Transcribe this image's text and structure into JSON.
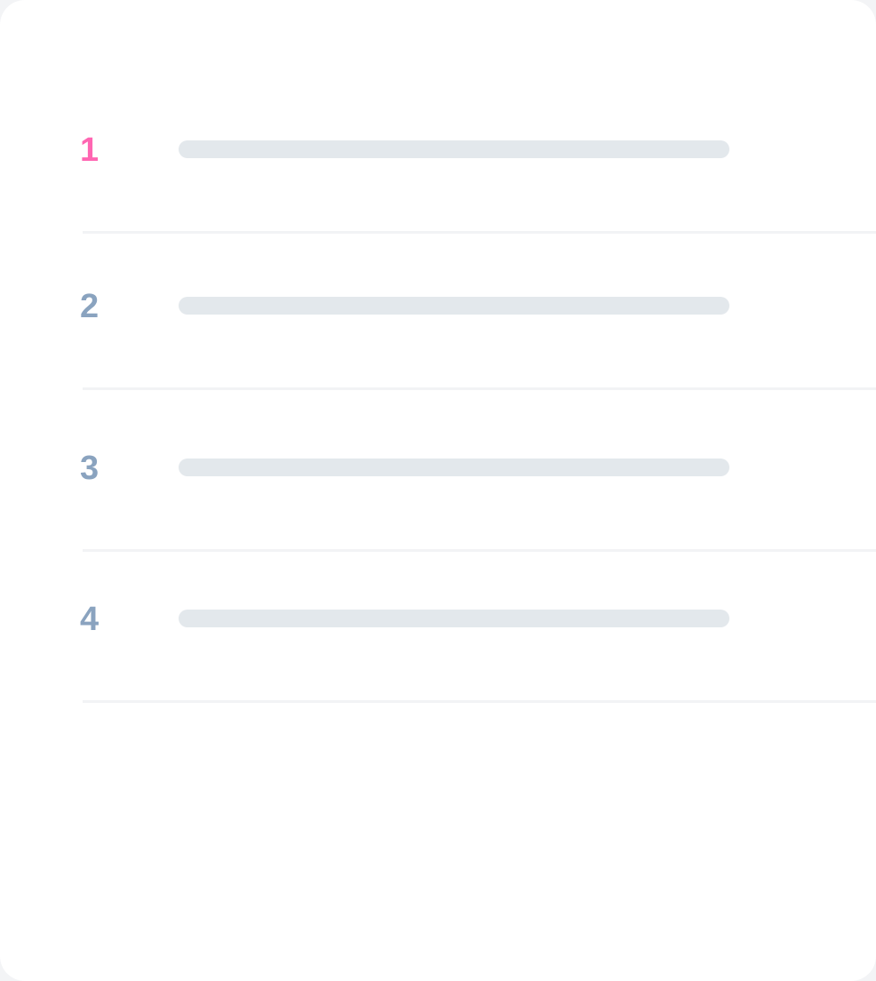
{
  "list": {
    "items": [
      {
        "number": "1",
        "active": true
      },
      {
        "number": "2",
        "active": false
      },
      {
        "number": "3",
        "active": false
      },
      {
        "number": "4",
        "active": false
      }
    ]
  },
  "colors": {
    "active_number": "#ff66b2",
    "inactive_number": "#8aa3bf",
    "placeholder_bar": "#e3e8ec",
    "divider": "#f2f3f5",
    "card_background": "#ffffff"
  }
}
